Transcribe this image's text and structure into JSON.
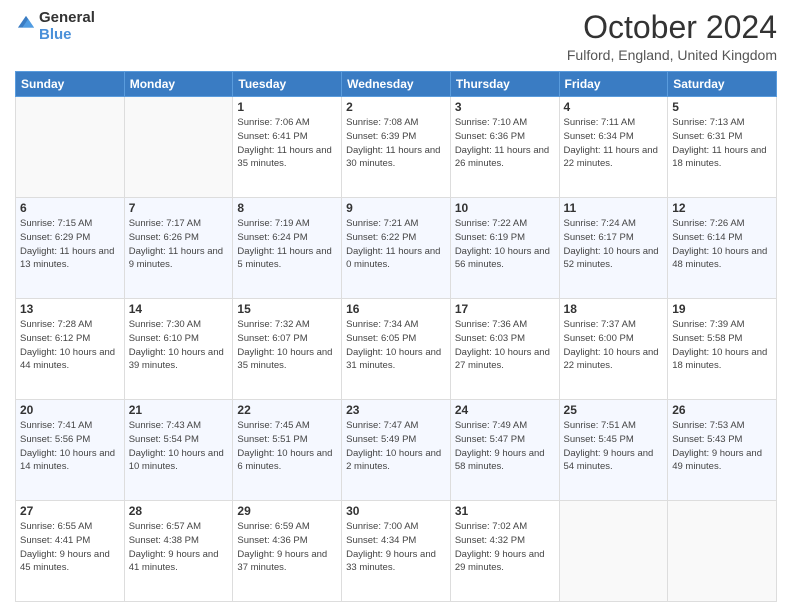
{
  "header": {
    "logo_general": "General",
    "logo_blue": "Blue",
    "month_title": "October 2024",
    "location": "Fulford, England, United Kingdom"
  },
  "days_of_week": [
    "Sunday",
    "Monday",
    "Tuesday",
    "Wednesday",
    "Thursday",
    "Friday",
    "Saturday"
  ],
  "weeks": [
    [
      {
        "day": "",
        "sunrise": "",
        "sunset": "",
        "daylight": ""
      },
      {
        "day": "",
        "sunrise": "",
        "sunset": "",
        "daylight": ""
      },
      {
        "day": "1",
        "sunrise": "Sunrise: 7:06 AM",
        "sunset": "Sunset: 6:41 PM",
        "daylight": "Daylight: 11 hours and 35 minutes."
      },
      {
        "day": "2",
        "sunrise": "Sunrise: 7:08 AM",
        "sunset": "Sunset: 6:39 PM",
        "daylight": "Daylight: 11 hours and 30 minutes."
      },
      {
        "day": "3",
        "sunrise": "Sunrise: 7:10 AM",
        "sunset": "Sunset: 6:36 PM",
        "daylight": "Daylight: 11 hours and 26 minutes."
      },
      {
        "day": "4",
        "sunrise": "Sunrise: 7:11 AM",
        "sunset": "Sunset: 6:34 PM",
        "daylight": "Daylight: 11 hours and 22 minutes."
      },
      {
        "day": "5",
        "sunrise": "Sunrise: 7:13 AM",
        "sunset": "Sunset: 6:31 PM",
        "daylight": "Daylight: 11 hours and 18 minutes."
      }
    ],
    [
      {
        "day": "6",
        "sunrise": "Sunrise: 7:15 AM",
        "sunset": "Sunset: 6:29 PM",
        "daylight": "Daylight: 11 hours and 13 minutes."
      },
      {
        "day": "7",
        "sunrise": "Sunrise: 7:17 AM",
        "sunset": "Sunset: 6:26 PM",
        "daylight": "Daylight: 11 hours and 9 minutes."
      },
      {
        "day": "8",
        "sunrise": "Sunrise: 7:19 AM",
        "sunset": "Sunset: 6:24 PM",
        "daylight": "Daylight: 11 hours and 5 minutes."
      },
      {
        "day": "9",
        "sunrise": "Sunrise: 7:21 AM",
        "sunset": "Sunset: 6:22 PM",
        "daylight": "Daylight: 11 hours and 0 minutes."
      },
      {
        "day": "10",
        "sunrise": "Sunrise: 7:22 AM",
        "sunset": "Sunset: 6:19 PM",
        "daylight": "Daylight: 10 hours and 56 minutes."
      },
      {
        "day": "11",
        "sunrise": "Sunrise: 7:24 AM",
        "sunset": "Sunset: 6:17 PM",
        "daylight": "Daylight: 10 hours and 52 minutes."
      },
      {
        "day": "12",
        "sunrise": "Sunrise: 7:26 AM",
        "sunset": "Sunset: 6:14 PM",
        "daylight": "Daylight: 10 hours and 48 minutes."
      }
    ],
    [
      {
        "day": "13",
        "sunrise": "Sunrise: 7:28 AM",
        "sunset": "Sunset: 6:12 PM",
        "daylight": "Daylight: 10 hours and 44 minutes."
      },
      {
        "day": "14",
        "sunrise": "Sunrise: 7:30 AM",
        "sunset": "Sunset: 6:10 PM",
        "daylight": "Daylight: 10 hours and 39 minutes."
      },
      {
        "day": "15",
        "sunrise": "Sunrise: 7:32 AM",
        "sunset": "Sunset: 6:07 PM",
        "daylight": "Daylight: 10 hours and 35 minutes."
      },
      {
        "day": "16",
        "sunrise": "Sunrise: 7:34 AM",
        "sunset": "Sunset: 6:05 PM",
        "daylight": "Daylight: 10 hours and 31 minutes."
      },
      {
        "day": "17",
        "sunrise": "Sunrise: 7:36 AM",
        "sunset": "Sunset: 6:03 PM",
        "daylight": "Daylight: 10 hours and 27 minutes."
      },
      {
        "day": "18",
        "sunrise": "Sunrise: 7:37 AM",
        "sunset": "Sunset: 6:00 PM",
        "daylight": "Daylight: 10 hours and 22 minutes."
      },
      {
        "day": "19",
        "sunrise": "Sunrise: 7:39 AM",
        "sunset": "Sunset: 5:58 PM",
        "daylight": "Daylight: 10 hours and 18 minutes."
      }
    ],
    [
      {
        "day": "20",
        "sunrise": "Sunrise: 7:41 AM",
        "sunset": "Sunset: 5:56 PM",
        "daylight": "Daylight: 10 hours and 14 minutes."
      },
      {
        "day": "21",
        "sunrise": "Sunrise: 7:43 AM",
        "sunset": "Sunset: 5:54 PM",
        "daylight": "Daylight: 10 hours and 10 minutes."
      },
      {
        "day": "22",
        "sunrise": "Sunrise: 7:45 AM",
        "sunset": "Sunset: 5:51 PM",
        "daylight": "Daylight: 10 hours and 6 minutes."
      },
      {
        "day": "23",
        "sunrise": "Sunrise: 7:47 AM",
        "sunset": "Sunset: 5:49 PM",
        "daylight": "Daylight: 10 hours and 2 minutes."
      },
      {
        "day": "24",
        "sunrise": "Sunrise: 7:49 AM",
        "sunset": "Sunset: 5:47 PM",
        "daylight": "Daylight: 9 hours and 58 minutes."
      },
      {
        "day": "25",
        "sunrise": "Sunrise: 7:51 AM",
        "sunset": "Sunset: 5:45 PM",
        "daylight": "Daylight: 9 hours and 54 minutes."
      },
      {
        "day": "26",
        "sunrise": "Sunrise: 7:53 AM",
        "sunset": "Sunset: 5:43 PM",
        "daylight": "Daylight: 9 hours and 49 minutes."
      }
    ],
    [
      {
        "day": "27",
        "sunrise": "Sunrise: 6:55 AM",
        "sunset": "Sunset: 4:41 PM",
        "daylight": "Daylight: 9 hours and 45 minutes."
      },
      {
        "day": "28",
        "sunrise": "Sunrise: 6:57 AM",
        "sunset": "Sunset: 4:38 PM",
        "daylight": "Daylight: 9 hours and 41 minutes."
      },
      {
        "day": "29",
        "sunrise": "Sunrise: 6:59 AM",
        "sunset": "Sunset: 4:36 PM",
        "daylight": "Daylight: 9 hours and 37 minutes."
      },
      {
        "day": "30",
        "sunrise": "Sunrise: 7:00 AM",
        "sunset": "Sunset: 4:34 PM",
        "daylight": "Daylight: 9 hours and 33 minutes."
      },
      {
        "day": "31",
        "sunrise": "Sunrise: 7:02 AM",
        "sunset": "Sunset: 4:32 PM",
        "daylight": "Daylight: 9 hours and 29 minutes."
      },
      {
        "day": "",
        "sunrise": "",
        "sunset": "",
        "daylight": ""
      },
      {
        "day": "",
        "sunrise": "",
        "sunset": "",
        "daylight": ""
      }
    ]
  ]
}
